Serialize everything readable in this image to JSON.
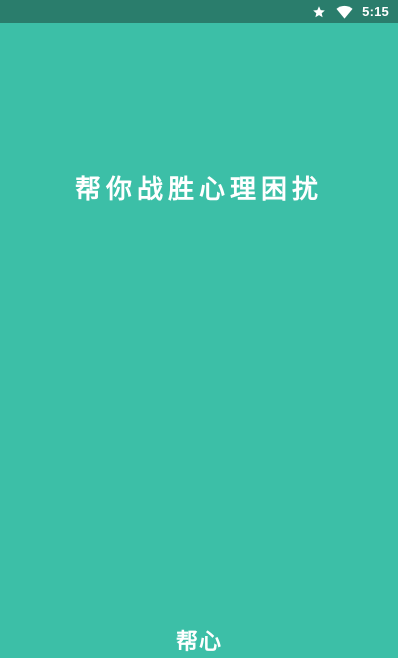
{
  "status_bar": {
    "time": "5:15",
    "icons": [
      "star-icon",
      "wifi-icon"
    ]
  },
  "splash": {
    "slogan": "帮你战胜心理困扰",
    "app_name": "帮心",
    "background_color": "#3cbfa7",
    "status_bar_color": "#2a7d6c",
    "text_color": "#ffffff"
  }
}
